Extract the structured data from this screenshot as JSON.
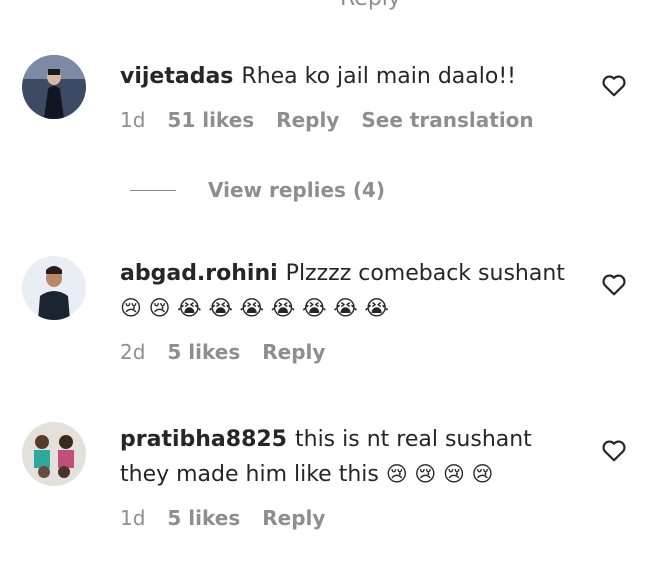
{
  "top_partial": "Reply",
  "comments": [
    {
      "username": "vijetadas",
      "text": "Rhea ko jail main daalo!!",
      "emojis": "",
      "time": "1d",
      "likes": "51 likes",
      "reply": "Reply",
      "translation": "See translation"
    },
    {
      "username": "abgad.rohini",
      "text": "Plzzzz comeback sushant",
      "emojis": "😢 😢 😭 😭 😭 😭 😭 😭 😭",
      "time": "2d",
      "likes": "5 likes",
      "reply": "Reply"
    },
    {
      "username": "pratibha8825",
      "text": "this is nt real sushant they made him like this",
      "emojis": "😢 😢 😢 😢",
      "time": "1d",
      "likes": "5 likes",
      "reply": "Reply"
    }
  ],
  "view_replies": "View replies (4)",
  "icons": {
    "like": "heart-outline-icon"
  },
  "colors": {
    "text": "#262626",
    "secondary": "#8e8e8e"
  }
}
